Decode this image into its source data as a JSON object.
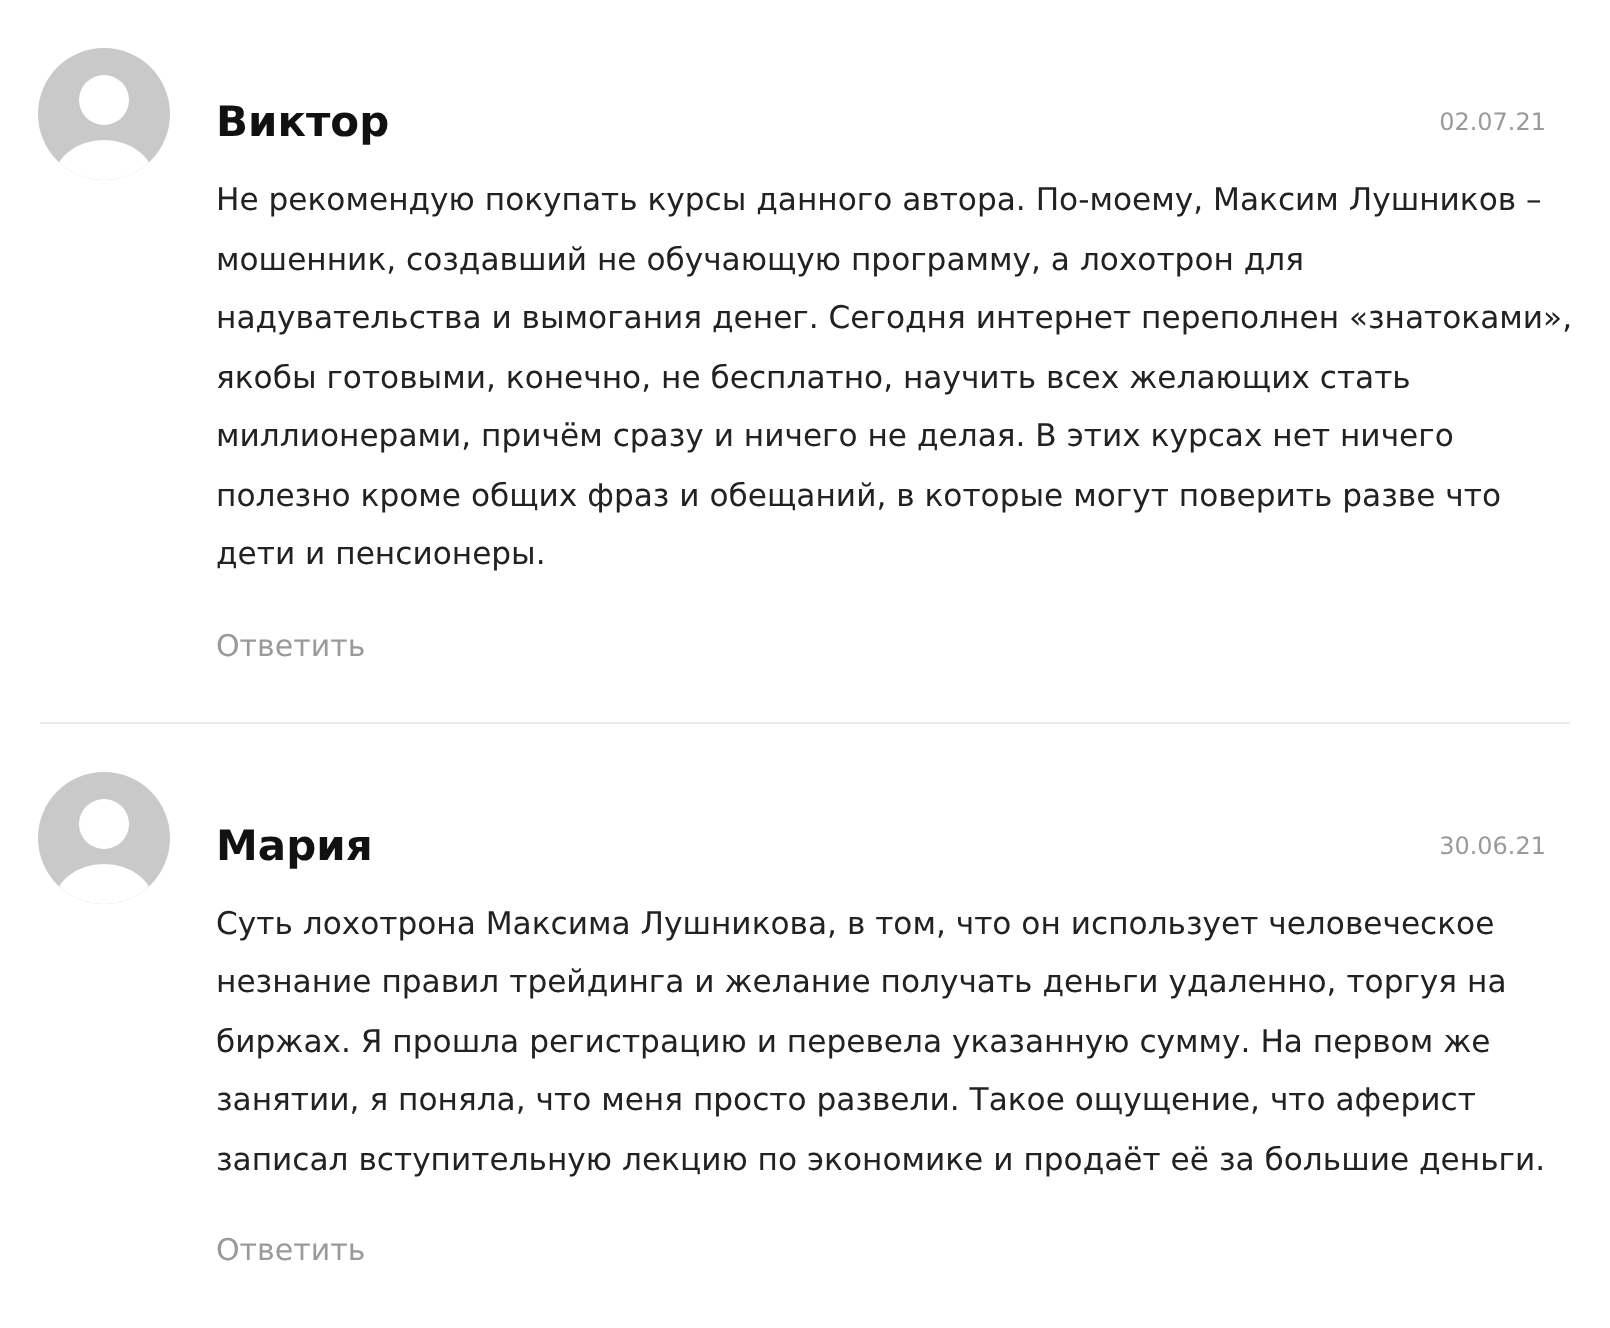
{
  "comments": [
    {
      "author": "Виктор",
      "date": "02.07.21",
      "text": "Не рекомендую покупать курсы данного автора. По-моему, Максим Лушников – мошенник, создавший не обучающую программу, а лохотрон для надувательства и вымогания денег. Сегодня интернет переполнен «знатоками», якобы готовыми, конечно, не бесплатно, научить всех желающих стать миллионерами, причём сразу и ничего не делая. В этих курсах нет ничего полезно кроме общих фраз и обещаний, в которые могут поверить разве что дети и пенсионеры.",
      "reply": "Ответить"
    },
    {
      "author": "Мария",
      "date": "30.06.21",
      "text": "Суть лохотрона Максима Лушникова, в том, что он использует человеческое незнание правил трейдинга и желание получать деньги удаленно, торгуя на биржах. Я прошла регистрацию и перевела указанную сумму. На первом же занятии, я поняла, что меня просто развели. Такое ощущение, что аферист записал вступительную лекцию по экономике и продаёт её за большие деньги.",
      "reply": "Ответить"
    }
  ]
}
